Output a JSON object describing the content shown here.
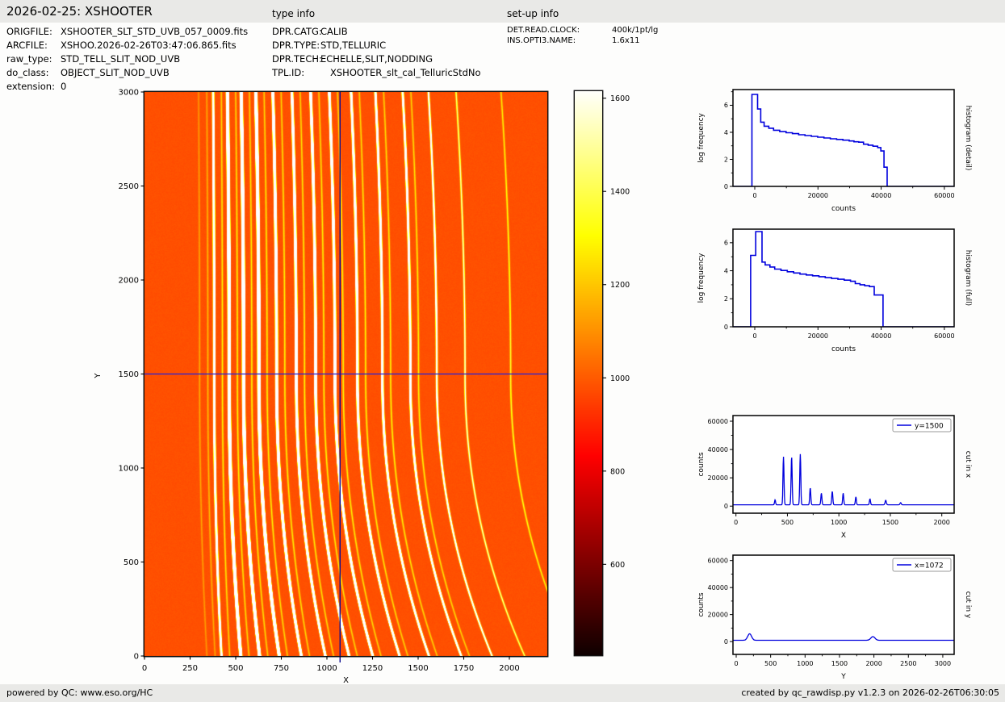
{
  "header": {
    "title": "2026-02-25: XSHOOTER",
    "type_info_label": "type info",
    "setup_info_label": "set-up info"
  },
  "file_info": {
    "rows": [
      {
        "label": "ORIGFILE:",
        "value": "XSHOOTER_SLT_STD_UVB_057_0009.fits"
      },
      {
        "label": "ARCFILE:",
        "value": "XSHOO.2026-02-26T03:47:06.865.fits"
      },
      {
        "label": "raw_type:",
        "value": "STD_TELL_SLIT_NOD_UVB"
      },
      {
        "label": "do_class:",
        "value": "OBJECT_SLIT_NOD_UVB"
      },
      {
        "label": "extension:",
        "value": "0"
      }
    ]
  },
  "type_info": {
    "rows": [
      {
        "label": "DPR.CATG:",
        "value": "CALIB"
      },
      {
        "label": "DPR.TYPE:",
        "value": "STD,TELLURIC"
      },
      {
        "label": "DPR.TECH:",
        "value": "ECHELLE,SLIT,NODDING"
      },
      {
        "label": "TPL.ID:",
        "value": "XSHOOTER_slt_cal_TelluricStdNo"
      }
    ]
  },
  "setup_info": {
    "rows": [
      {
        "label": "DET.READ.CLOCK:",
        "value": "400k/1pt/lg"
      },
      {
        "label": "INS.OPTI3.NAME:",
        "value": "1.6x11"
      }
    ]
  },
  "footer": {
    "left": "powered by QC: www.eso.org/HC",
    "right": "created by qc_rawdisp.py v1.2.3 on 2026-02-26T06:30:05"
  },
  "colors": {
    "line_blue": "#0000dd",
    "crosshair_vertical": "#0b0b8f",
    "crosshair_horizontal": "#2222dd",
    "band_gray": "#e9e9e7",
    "frame_black": "#111111"
  },
  "chart_data": [
    {
      "id": "main_image",
      "type": "heatmap",
      "xlabel": "X",
      "ylabel": "Y",
      "xlim": [
        0,
        2208
      ],
      "ylim": [
        0,
        3000
      ],
      "xticks": [
        0,
        250,
        500,
        750,
        1000,
        1250,
        1500,
        1750,
        2000
      ],
      "yticks": [
        0,
        500,
        1000,
        1500,
        2000,
        2500,
        3000
      ],
      "colormap": "hot",
      "vmin": 380,
      "vmax": 1620,
      "background_level": 980,
      "crosshair": {
        "x": 1072,
        "y": 1500
      },
      "sigma": 3.2,
      "orders": [
        {
          "x": 380,
          "amp": 3500
        },
        {
          "x": 462,
          "amp": 34000
        },
        {
          "x": 541,
          "amp": 34000
        },
        {
          "x": 625,
          "amp": 35800
        },
        {
          "x": 722,
          "amp": 12000
        },
        {
          "x": 830,
          "amp": 8200
        },
        {
          "x": 936,
          "amp": 9500
        },
        {
          "x": 1042,
          "amp": 8200
        },
        {
          "x": 1165,
          "amp": 5600
        },
        {
          "x": 1302,
          "amp": 4200
        },
        {
          "x": 1455,
          "amp": 3200
        },
        {
          "x": 1600,
          "amp": 1500
        },
        {
          "x": 1755,
          "amp": 650
        },
        {
          "x": 2005,
          "amp": 380
        }
      ],
      "ghosts": [
        {
          "x": 300,
          "amp": 170
        },
        {
          "x": 345,
          "amp": 210
        }
      ],
      "companion": {
        "offset": 45,
        "amp": 320
      },
      "curvature": {
        "c_base": 40,
        "c_step": 24,
        "top_frac": -0.15,
        "exp_top": 2,
        "exp_bottom": 2.1,
        "pivot_y": 1500
      }
    },
    {
      "id": "colorbar",
      "type": "colorbar",
      "colormap": "hot",
      "ticks": [
        600,
        800,
        1000,
        1200,
        1400,
        1600
      ],
      "vmin": 405,
      "vmax": 1615
    },
    {
      "id": "hist_detail",
      "type": "line",
      "xlabel": "counts",
      "ylabel": "log frequency",
      "right_label": "histogram (detail)",
      "xlim": [
        -6900,
        63100
      ],
      "ylim": [
        0,
        7.16
      ],
      "xticks": [
        0,
        20000,
        40000,
        60000
      ],
      "yticks": [
        0,
        2,
        4,
        6
      ],
      "series": [
        {
          "name": "histogram",
          "color": "#0000dd",
          "points": [
            [
              -6900,
              0
            ],
            [
              -900,
              0
            ],
            [
              -900,
              6.8
            ],
            [
              900,
              6.8
            ],
            [
              900,
              5.72
            ],
            [
              1900,
              5.72
            ],
            [
              1900,
              4.75
            ],
            [
              2950,
              4.75
            ],
            [
              2950,
              4.45
            ],
            [
              4450,
              4.45
            ],
            [
              4450,
              4.3
            ],
            [
              5950,
              4.3
            ],
            [
              5950,
              4.15
            ],
            [
              7900,
              4.15
            ],
            [
              7900,
              4.05
            ],
            [
              9900,
              4.05
            ],
            [
              9900,
              3.97
            ],
            [
              11900,
              3.97
            ],
            [
              11900,
              3.9
            ],
            [
              13900,
              3.9
            ],
            [
              13900,
              3.82
            ],
            [
              15900,
              3.82
            ],
            [
              15900,
              3.76
            ],
            [
              17900,
              3.76
            ],
            [
              17900,
              3.7
            ],
            [
              19900,
              3.7
            ],
            [
              19900,
              3.64
            ],
            [
              21900,
              3.64
            ],
            [
              21900,
              3.58
            ],
            [
              23900,
              3.58
            ],
            [
              23900,
              3.52
            ],
            [
              25900,
              3.52
            ],
            [
              25900,
              3.47
            ],
            [
              27900,
              3.47
            ],
            [
              27900,
              3.42
            ],
            [
              29900,
              3.42
            ],
            [
              29900,
              3.36
            ],
            [
              31400,
              3.36
            ],
            [
              31400,
              3.3
            ],
            [
              32900,
              3.3
            ],
            [
              32900,
              3.27
            ],
            [
              34400,
              3.27
            ],
            [
              34400,
              3.12
            ],
            [
              35900,
              3.12
            ],
            [
              35900,
              3.05
            ],
            [
              37400,
              3.05
            ],
            [
              37400,
              2.97
            ],
            [
              38900,
              2.97
            ],
            [
              38900,
              2.87
            ],
            [
              39900,
              2.87
            ],
            [
              39900,
              2.62
            ],
            [
              40900,
              2.62
            ],
            [
              40900,
              1.42
            ],
            [
              41900,
              1.42
            ],
            [
              41900,
              0
            ],
            [
              63100,
              0
            ]
          ]
        }
      ]
    },
    {
      "id": "hist_full",
      "type": "line",
      "xlabel": "counts",
      "ylabel": "log frequency",
      "right_label": "histogram (full)",
      "xlim": [
        -6900,
        63100
      ],
      "ylim": [
        0,
        6.97
      ],
      "xticks": [
        0,
        20000,
        40000,
        60000
      ],
      "yticks": [
        0,
        2,
        4,
        6
      ],
      "series": [
        {
          "name": "histogram",
          "color": "#0000dd",
          "points": [
            [
              -6900,
              0
            ],
            [
              -1300,
              0
            ],
            [
              -1300,
              5.1
            ],
            [
              300,
              5.1
            ],
            [
              300,
              6.8
            ],
            [
              2300,
              6.8
            ],
            [
              2300,
              4.62
            ],
            [
              3300,
              4.62
            ],
            [
              3300,
              4.42
            ],
            [
              4800,
              4.42
            ],
            [
              4800,
              4.27
            ],
            [
              6300,
              4.27
            ],
            [
              6300,
              4.12
            ],
            [
              8300,
              4.12
            ],
            [
              8300,
              4.02
            ],
            [
              10300,
              4.02
            ],
            [
              10300,
              3.93
            ],
            [
              12300,
              3.93
            ],
            [
              12300,
              3.84
            ],
            [
              14300,
              3.84
            ],
            [
              14300,
              3.76
            ],
            [
              16300,
              3.76
            ],
            [
              16300,
              3.7
            ],
            [
              18300,
              3.7
            ],
            [
              18300,
              3.64
            ],
            [
              20300,
              3.64
            ],
            [
              20300,
              3.58
            ],
            [
              22300,
              3.58
            ],
            [
              22300,
              3.51
            ],
            [
              24300,
              3.51
            ],
            [
              24300,
              3.45
            ],
            [
              26300,
              3.45
            ],
            [
              26300,
              3.39
            ],
            [
              28300,
              3.39
            ],
            [
              28300,
              3.33
            ],
            [
              30300,
              3.33
            ],
            [
              30300,
              3.25
            ],
            [
              31800,
              3.25
            ],
            [
              31800,
              3.08
            ],
            [
              33300,
              3.08
            ],
            [
              33300,
              3.0
            ],
            [
              34800,
              3.0
            ],
            [
              34800,
              2.93
            ],
            [
              36300,
              2.93
            ],
            [
              36300,
              2.87
            ],
            [
              37800,
              2.87
            ],
            [
              37800,
              2.27
            ],
            [
              40600,
              2.27
            ],
            [
              40600,
              0
            ],
            [
              63100,
              0
            ]
          ]
        }
      ]
    },
    {
      "id": "cut_x",
      "type": "line",
      "xlabel": "X",
      "ylabel": "counts",
      "right_label": "cut in x",
      "legend_label": "y=1500",
      "color": "#0000dd",
      "xlim": [
        -29,
        2120
      ],
      "ylim": [
        -5000,
        64000
      ],
      "xticks": [
        0,
        500,
        1000,
        1500,
        2000
      ],
      "yticks": [
        0,
        20000,
        40000,
        60000
      ],
      "baseline": 950,
      "peaks": [
        {
          "x": 380,
          "amp": 3500,
          "sigma": 5
        },
        {
          "x": 462,
          "amp": 34000,
          "sigma": 5
        },
        {
          "x": 541,
          "amp": 34000,
          "sigma": 5
        },
        {
          "x": 625,
          "amp": 35800,
          "sigma": 5
        },
        {
          "x": 722,
          "amp": 12000,
          "sigma": 5
        },
        {
          "x": 830,
          "amp": 8200,
          "sigma": 5
        },
        {
          "x": 936,
          "amp": 9500,
          "sigma": 5
        },
        {
          "x": 1042,
          "amp": 8200,
          "sigma": 5
        },
        {
          "x": 1165,
          "amp": 5600,
          "sigma": 5
        },
        {
          "x": 1302,
          "amp": 4200,
          "sigma": 5
        },
        {
          "x": 1455,
          "amp": 3200,
          "sigma": 6
        },
        {
          "x": 1600,
          "amp": 1500,
          "sigma": 6
        }
      ]
    },
    {
      "id": "cut_y",
      "type": "line",
      "xlabel": "Y",
      "ylabel": "counts",
      "right_label": "cut in y",
      "legend_label": "x=1072",
      "color": "#0000dd",
      "xlim": [
        -47,
        3165
      ],
      "ylim": [
        -9500,
        64000
      ],
      "xticks": [
        0,
        500,
        1000,
        1500,
        2000,
        2500,
        3000
      ],
      "yticks": [
        0,
        20000,
        40000,
        60000
      ],
      "baseline": 950,
      "peaks": [
        {
          "x": 195,
          "amp": 4800,
          "sigma": 28
        },
        {
          "x": 1985,
          "amp": 2700,
          "sigma": 30
        }
      ]
    }
  ]
}
